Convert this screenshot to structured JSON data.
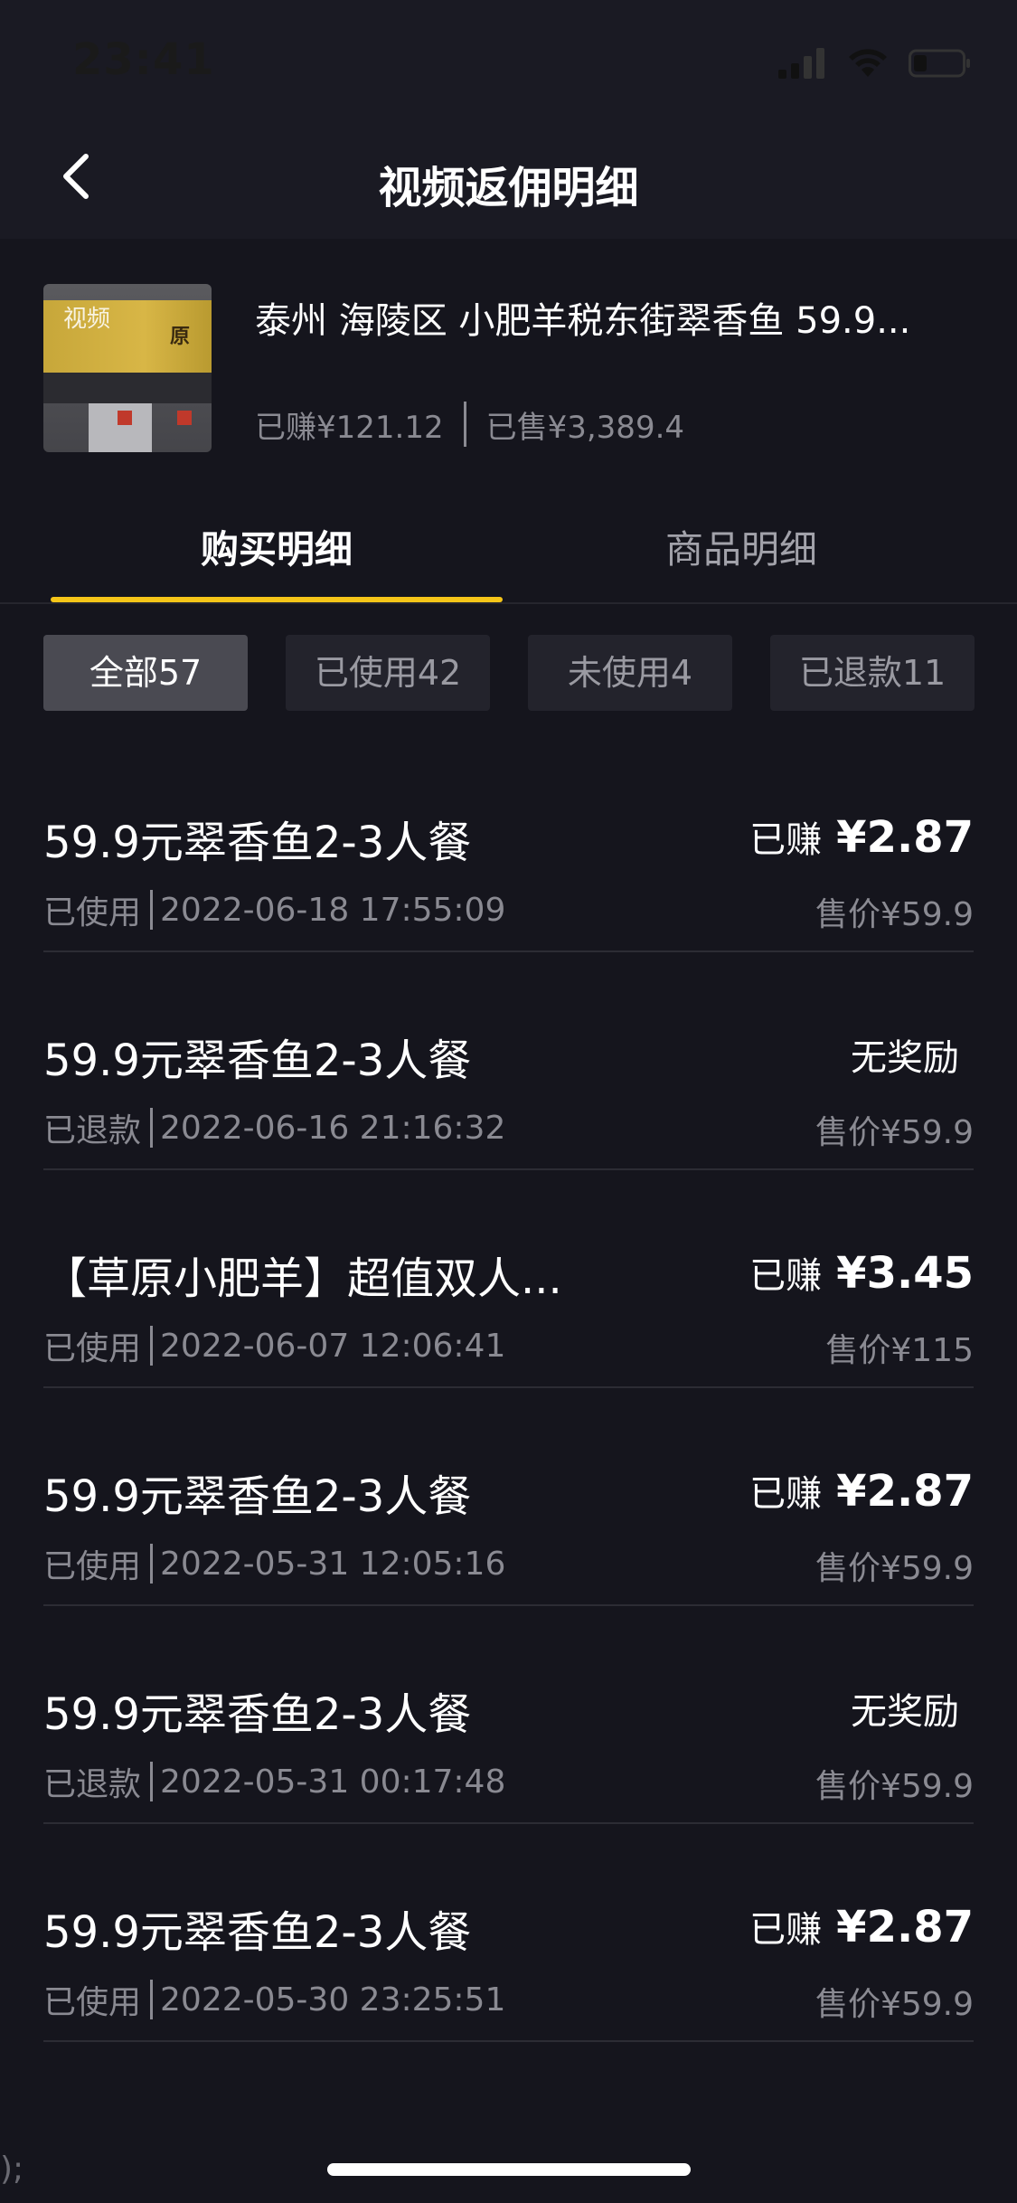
{
  "status_bar": {
    "time": "23:41"
  },
  "nav": {
    "title": "视频返佣明细"
  },
  "product": {
    "thumbnail_label": "视频",
    "thumbnail_sign": "原",
    "title": "泰州 海陵区 小肥羊税东街翠香鱼 59.9...",
    "earned": "已赚¥121.12",
    "sold": "已售¥3,389.4"
  },
  "tabs": [
    {
      "label": "购买明细",
      "active": true
    },
    {
      "label": "商品明细",
      "active": false
    }
  ],
  "filters": [
    {
      "label": "全部57",
      "selected": true
    },
    {
      "label": "已使用42",
      "selected": false
    },
    {
      "label": "未使用4",
      "selected": false
    },
    {
      "label": "已退款11",
      "selected": false
    }
  ],
  "orders": [
    {
      "name": "59.9元翠香鱼2-3人餐",
      "status": "已使用",
      "time": "2022-06-18 17:55:09",
      "earn_label": "已赚",
      "earn_amount": "¥2.87",
      "price": "售价¥59.9"
    },
    {
      "name": "59.9元翠香鱼2-3人餐",
      "status": "已退款",
      "time": "2022-06-16 21:16:32",
      "earn_label": "无奖励",
      "earn_amount": "",
      "price": "售价¥59.9"
    },
    {
      "name": "【草原小肥羊】超值双人...",
      "status": "已使用",
      "time": "2022-06-07 12:06:41",
      "earn_label": "已赚",
      "earn_amount": "¥3.45",
      "price": "售价¥115"
    },
    {
      "name": "59.9元翠香鱼2-3人餐",
      "status": "已使用",
      "time": "2022-05-31 12:05:16",
      "earn_label": "已赚",
      "earn_amount": "¥2.87",
      "price": "售价¥59.9"
    },
    {
      "name": "59.9元翠香鱼2-3人餐",
      "status": "已退款",
      "time": "2022-05-31 00:17:48",
      "earn_label": "无奖励",
      "earn_amount": "",
      "price": "售价¥59.9"
    },
    {
      "name": "59.9元翠香鱼2-3人餐",
      "status": "已使用",
      "time": "2022-05-30 23:25:51",
      "earn_label": "已赚",
      "earn_amount": "¥2.87",
      "price": "售价¥59.9"
    }
  ],
  "edge_mark": ");",
  "colors": {
    "background": "#15151d",
    "accent": "#f5c518",
    "secondary_text": "#8a8a92"
  },
  "icons": [
    "signal-icon",
    "wifi-icon",
    "battery-icon",
    "back-arrow-icon"
  ]
}
